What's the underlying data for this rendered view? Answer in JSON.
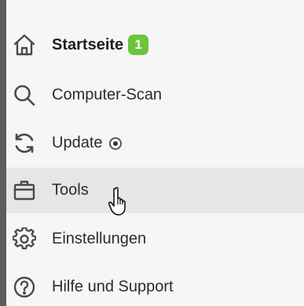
{
  "nav": {
    "items": [
      {
        "label": "Startseite",
        "icon": "home-icon",
        "badge": "1",
        "active": true
      },
      {
        "label": "Computer-Scan",
        "icon": "search-icon"
      },
      {
        "label": "Update",
        "icon": "refresh-icon",
        "indicator": "radio-dot"
      },
      {
        "label": "Tools",
        "icon": "toolbox-icon",
        "hovered": true
      },
      {
        "label": "Einstellungen",
        "icon": "gear-icon"
      },
      {
        "label": "Hilfe und Support",
        "icon": "help-icon"
      }
    ]
  },
  "cursor": {
    "icon": "hand-pointer-icon"
  },
  "colors": {
    "badge": "#6ac53a",
    "hover_background": "#e6e6e6",
    "nav_background": "#f6f6f6",
    "left_strip": "#5c5c5c",
    "icon_stroke": "#4a4a4a"
  }
}
